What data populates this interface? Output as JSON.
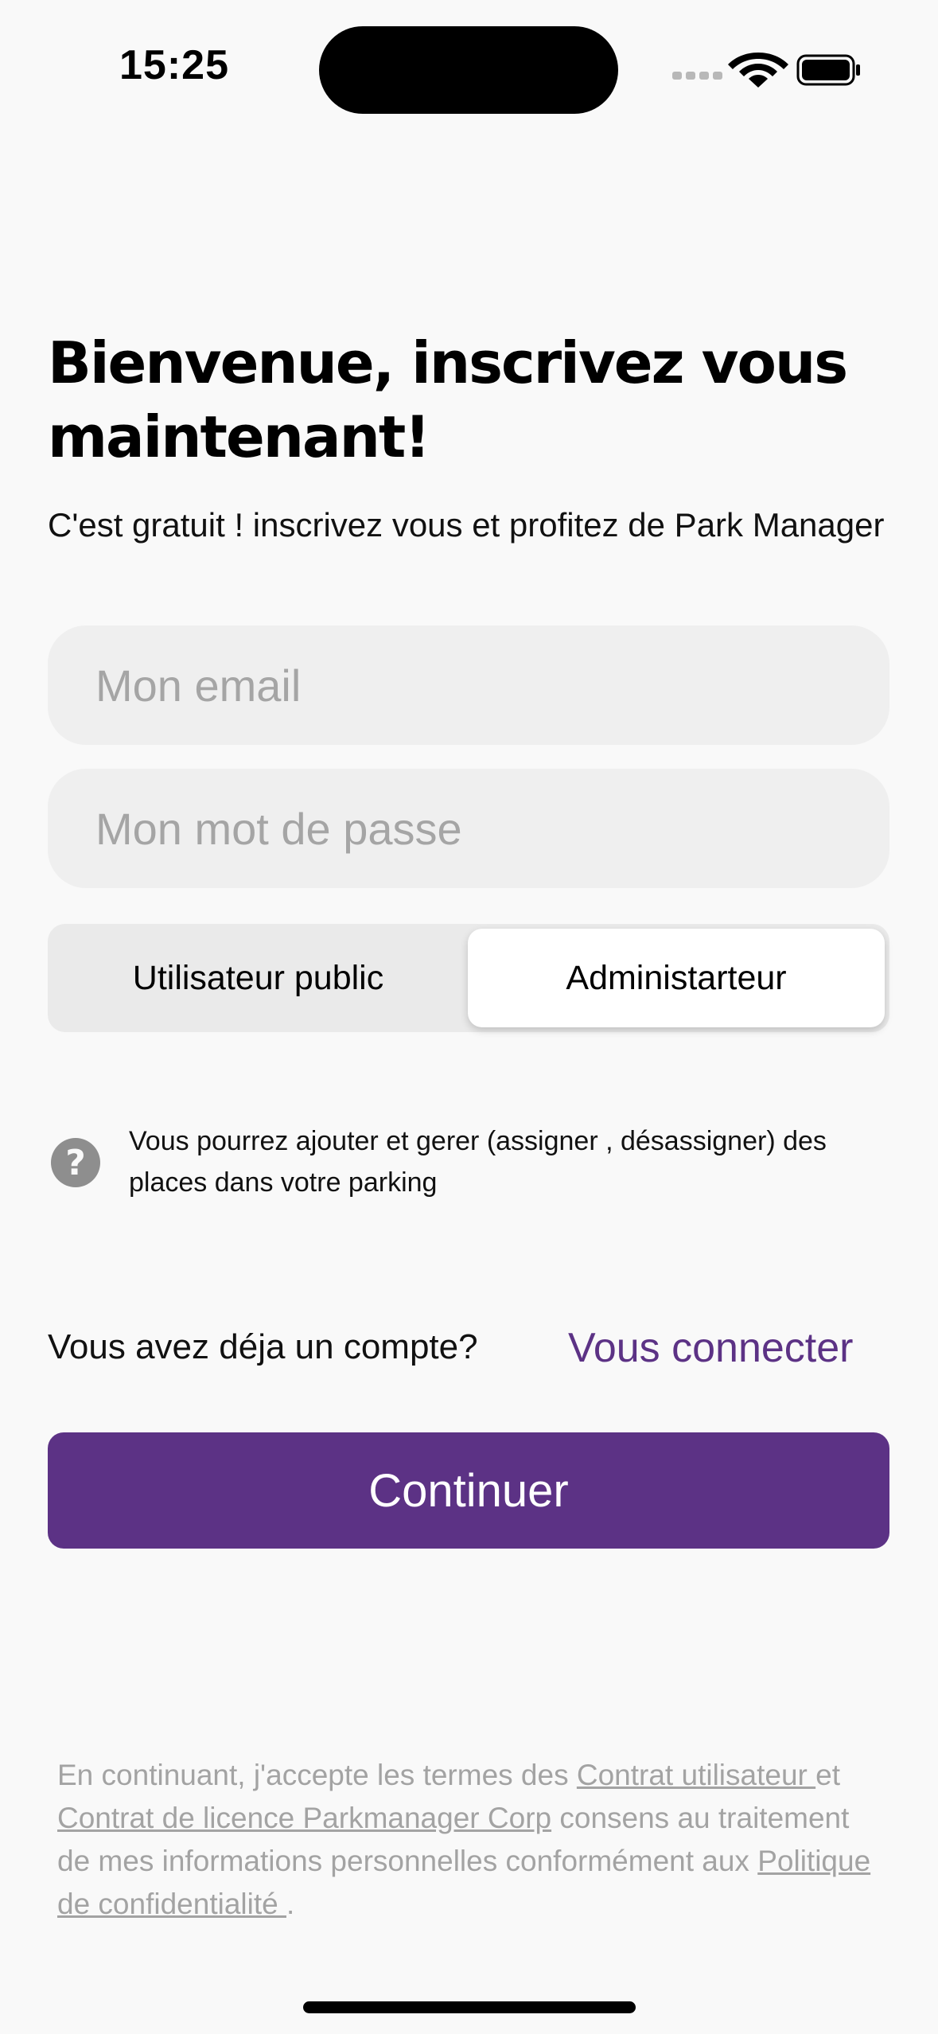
{
  "status_bar": {
    "time": "15:25",
    "icons": [
      "cellular-signal-icon",
      "wifi-icon",
      "battery-icon"
    ]
  },
  "header": {
    "title": "Bienvenue, inscrivez vous maintenant!",
    "subtitle": "C'est gratuit ! inscrivez vous et profitez de Park Manager"
  },
  "form": {
    "email_placeholder": "Mon email",
    "email_value": "",
    "password_placeholder": "Mon mot de passe",
    "password_value": ""
  },
  "role_selector": {
    "options": [
      "Utilisateur public",
      "Administarteur"
    ],
    "selected": "Administarteur"
  },
  "info": {
    "icon": "help-circle-icon",
    "text": "Vous pourrez ajouter et gerer (assigner , désassigner) des places dans votre parking"
  },
  "account": {
    "prompt": "Vous avez déja un compte?",
    "login_link": "Vous connecter"
  },
  "continue_label": "Continuer",
  "legal": {
    "part1": "En continuant, j'accepte les termes des ",
    "link1": "Contrat utilisateur ",
    "part2": "et ",
    "link2": "Contrat de licence Parkmanager Corp",
    "part3": " consens au traitement de mes informations personnelles conformément aux ",
    "link3": "Politique de confidentialité ",
    "part4": "."
  },
  "colors": {
    "primary": "#5c3285",
    "background": "#f9f9f9",
    "field_bg": "#efefef",
    "muted_text": "#a3a3a3"
  }
}
